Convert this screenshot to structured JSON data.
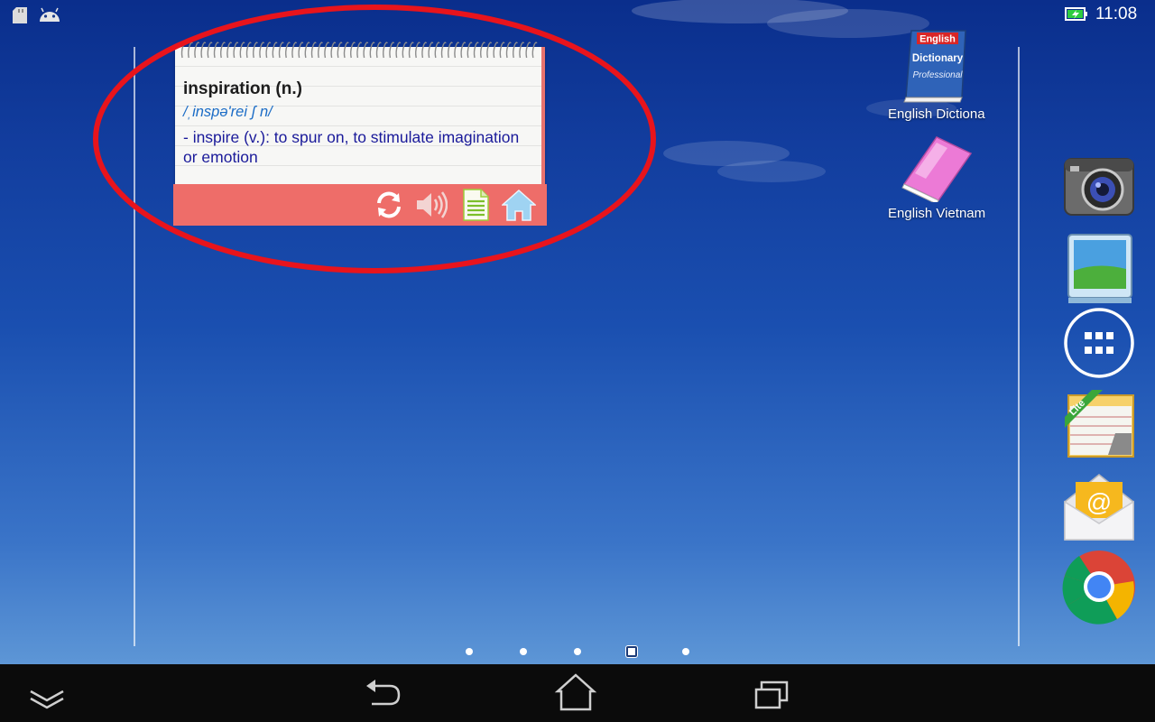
{
  "status_bar": {
    "time": "11:08",
    "left_icons": [
      "sd-card-icon",
      "android-icon"
    ],
    "right_icons": [
      "battery-charging-icon"
    ]
  },
  "dictionary_widget": {
    "word": "inspiration (n.)",
    "phonetic": "/ˌinspə'rei ʃ n/",
    "meaning": " - inspire (v.): to spur on, to stimulate imagination or emotion",
    "toolbar_icons": [
      "refresh-icon",
      "speaker-icon",
      "document-icon",
      "home-icon"
    ],
    "accent_color": "#ee6d69",
    "highlight_color": "#e8141c"
  },
  "desktop_shortcuts": [
    {
      "label": "English Dictiona",
      "icon": "english-dictionary-book-icon",
      "book_text": [
        "English",
        "Dictionary",
        "Professional"
      ]
    },
    {
      "label": "English Vietnam",
      "icon": "pink-book-icon"
    }
  ],
  "dock": [
    {
      "name": "camera-app-icon"
    },
    {
      "name": "gallery-app-icon"
    },
    {
      "name": "all-apps-icon"
    },
    {
      "name": "notes-lite-app-icon",
      "badge": "Lite"
    },
    {
      "name": "email-app-icon",
      "glyph": "@"
    },
    {
      "name": "chrome-app-icon"
    }
  ],
  "page_indicator": {
    "pages": 5,
    "current": 4
  },
  "navigation_bar": {
    "buttons": [
      "hide-keyboard-icon",
      "back-icon",
      "home-icon",
      "recent-apps-icon"
    ]
  }
}
